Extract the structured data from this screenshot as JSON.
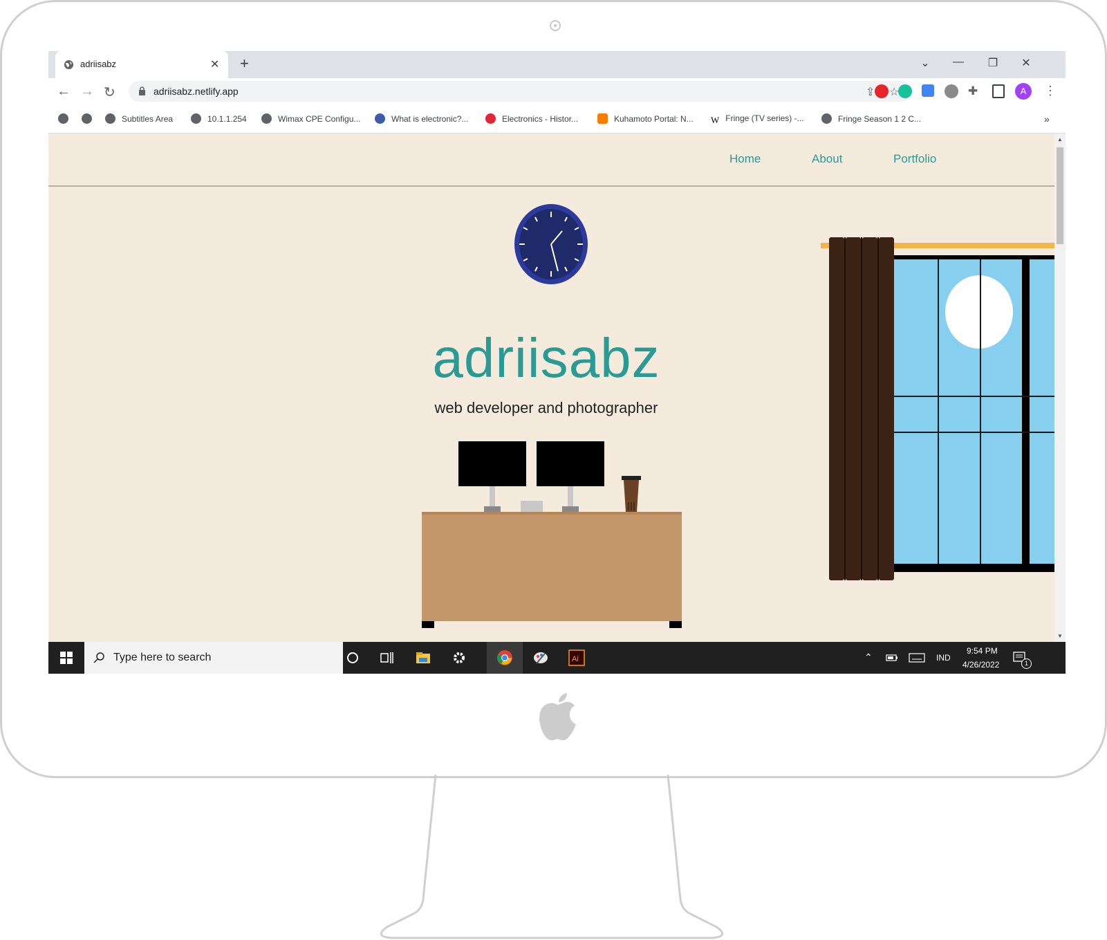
{
  "browser": {
    "tab_title": "adriisabz",
    "url": "adriisabz.netlify.app",
    "window_controls": {
      "dropdown": "⌄",
      "minimize": "—",
      "restore": "❐",
      "close": "✕"
    },
    "bookmarks": [
      {
        "label": "",
        "icon": "globe-icon"
      },
      {
        "label": "",
        "icon": "globe-icon"
      },
      {
        "label": "Subtitles Area",
        "icon": "globe-icon"
      },
      {
        "label": "10.1.1.254",
        "icon": "globe-icon"
      },
      {
        "label": "Wimax CPE Configu...",
        "icon": "globe-icon"
      },
      {
        "label": "What is electronic?...",
        "icon": "site-icon"
      },
      {
        "label": "Electronics - Histor...",
        "icon": "huawei-icon"
      },
      {
        "label": "Kuhamoto Portal: N...",
        "icon": "blogger-icon"
      },
      {
        "label": "Fringe (TV series) -...",
        "icon": "wikipedia-icon"
      },
      {
        "label": "Fringe Season 1 2 C...",
        "icon": "globe-icon"
      }
    ],
    "overflow": "»",
    "profile_initial": "A"
  },
  "site": {
    "nav": {
      "home": "Home",
      "about": "About",
      "portfolio": "Portfolio"
    },
    "title": "adriisabz",
    "subtitle": "web developer and photographer"
  },
  "taskbar": {
    "search_placeholder": "Type here to search",
    "lang": "IND",
    "time": "9:54 PM",
    "date": "4/26/2022",
    "notifications": "1"
  },
  "colors": {
    "page_bg": "#f5ebdc",
    "accent": "#2a9a95",
    "clock_face": "#1f2a6b",
    "desk": "#c4976a",
    "curtain": "#3b2416",
    "sky": "#87cfee",
    "rod": "#f2b44b"
  }
}
